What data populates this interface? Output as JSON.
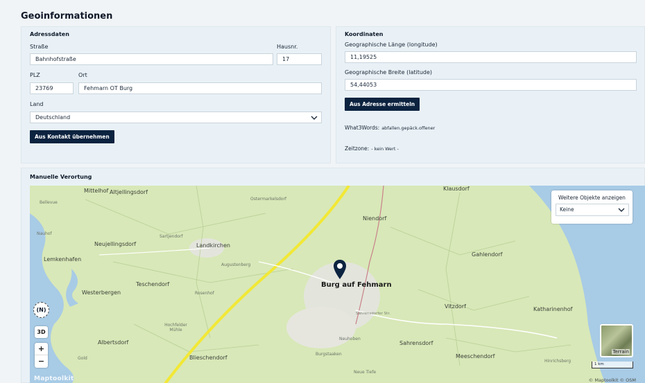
{
  "page": {
    "title": "Geoinformationen"
  },
  "address": {
    "section_title": "Adressdaten",
    "street_label": "Straße",
    "street_value": "Bahnhofstraße",
    "house_label": "Hausnr.",
    "house_value": "17",
    "zip_label": "PLZ",
    "zip_value": "23769",
    "city_label": "Ort",
    "city_value": "Fehmarn OT Burg",
    "country_label": "Land",
    "country_value": "Deutschland",
    "from_contact_button": "Aus Kontakt übernehmen"
  },
  "coordinates": {
    "section_title": "Koordinaten",
    "lon_label": "Geographische Länge (longitude)",
    "lon_value": "11,19525",
    "lat_label": "Geographische Breite (latitude)",
    "lat_value": "54,44053",
    "from_address_button": "Aus Adresse ermitteln",
    "w3w_label": "What3Words:",
    "w3w_value": "abfallen.gepäck.offener",
    "tz_label": "Zeitzone:",
    "tz_value": "- kein Wert -"
  },
  "map": {
    "section_title": "Manuelle Verortung",
    "overlay_title": "Weitere Objekte anzeigen",
    "overlay_value": "Keine",
    "compass": "(N)",
    "btn_3d": "3D",
    "zoom_in": "+",
    "zoom_out": "−",
    "terrain": "Terrain",
    "scale": "1 km",
    "attribution": "© Maptoolkit © OSM",
    "logo": "Maptoolkit",
    "pin_label": "Burg auf Fehmarn",
    "places": {
      "mittelhof": "Mittelhof",
      "altjellingsdorf": "Altjellingsdorf",
      "bellevue": "Bellevue",
      "ostermarkelsdorf": "Ostermarkelsdorf",
      "klausdorf": "Klausdorf",
      "niendorf": "Niendorf",
      "nauhof": "Nauhof",
      "neujellingsdorf": "Neujellingsdorf",
      "sartjendorf": "Sartjendorf",
      "landkirchen": "Landkirchen",
      "gahlendorf": "Gahlendorf",
      "lemkenhafen": "Lemkenhafen",
      "augustenberg": "Augustenberg",
      "teschendorf": "Teschendorf",
      "westerbergen": "Westerbergen",
      "rosenhof": "Rosenhof",
      "vitzdorf": "Vitzdorf",
      "katharinenhof": "Katharinenhof",
      "hochfelder": "Hochfelder Mühle",
      "albertsdorf": "Albertsdorf",
      "neuhoben": "Neuhoben",
      "sahrensdorf": "Sahrensdorf",
      "bliesendorf": "Blieschendorf",
      "burgstaaken": "Burgstaaken",
      "meeschendorf": "Meeschendorf",
      "hinrichsberg": "Hinrichsberg",
      "neuetiefe": "Neue Tiefe",
      "gold": "Gold",
      "sahrensdorfer": "Sahrensdorfer Str."
    }
  },
  "colors": {
    "accent": "#0c2340",
    "panel": "#e9f1f6",
    "motorway": "#f2e835",
    "water": "#a8cbe6",
    "land": "#d8e8b8"
  }
}
